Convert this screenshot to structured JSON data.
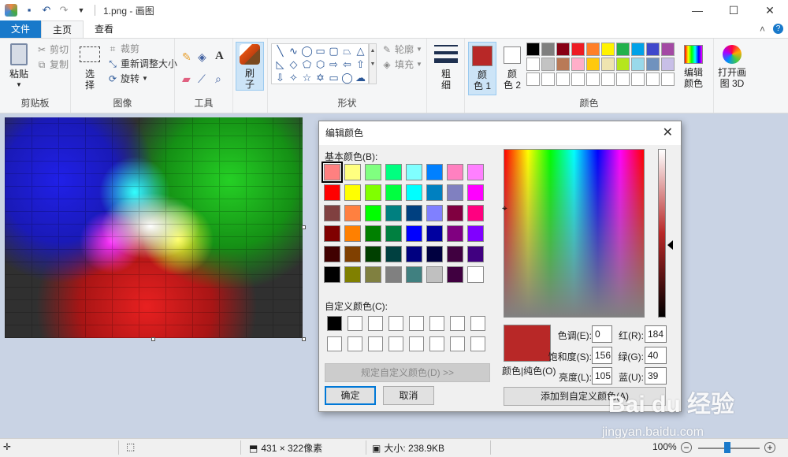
{
  "window": {
    "title": "1.png - 画图",
    "controls": [
      "—",
      "☐",
      "✕"
    ]
  },
  "tabs": {
    "file": "文件",
    "home": "主页",
    "view": "查看"
  },
  "ribbon": {
    "clipboard": {
      "paste": "粘贴",
      "cut": "剪切",
      "copy": "复制",
      "group": "剪贴板"
    },
    "image": {
      "select_line1": "选",
      "select_line2": "择",
      "crop": "裁剪",
      "resize": "重新调整大小",
      "rotate": "旋转",
      "group": "图像"
    },
    "tools": {
      "group": "工具"
    },
    "brush": {
      "line1": "刷",
      "line2": "子"
    },
    "shapes": {
      "outline": "轮廓",
      "fill": "填充",
      "group": "形状"
    },
    "size": {
      "line1": "粗",
      "line2": "细"
    },
    "colors": {
      "color1_line1": "颜",
      "color1_line2": "色 1",
      "color2_line1": "颜",
      "color2_line2": "色 2",
      "edit_line1": "编辑",
      "edit_line2": "颜色",
      "group": "颜色",
      "color1_value": "#b82827",
      "palette": [
        "#000000",
        "#7f7f7f",
        "#880015",
        "#ed1c24",
        "#ff7f27",
        "#fff200",
        "#22b14c",
        "#00a2e8",
        "#3f48cc",
        "#a349a4",
        "#ffffff",
        "#c3c3c3",
        "#b97a57",
        "#ffaec9",
        "#ffc90e",
        "#efe4b0",
        "#b5e61d",
        "#99d9ea",
        "#7092be",
        "#c8bfe7",
        "#ffffff",
        "#ffffff",
        "#ffffff",
        "#ffffff",
        "#ffffff",
        "#ffffff",
        "#ffffff",
        "#ffffff",
        "#ffffff",
        "#ffffff"
      ]
    },
    "paint3d": {
      "line1": "打开画",
      "line2": "图 3D"
    }
  },
  "dialog": {
    "title": "编辑颜色",
    "basic_colors_label": "基本颜色(B):",
    "basic_colors": [
      "#ff8080",
      "#ffff80",
      "#80ff80",
      "#00ff80",
      "#80ffff",
      "#0080ff",
      "#ff80c0",
      "#ff80ff",
      "#ff0000",
      "#ffff00",
      "#80ff00",
      "#00ff40",
      "#00ffff",
      "#0080c0",
      "#8080c0",
      "#ff00ff",
      "#804040",
      "#ff8040",
      "#00ff00",
      "#008080",
      "#004080",
      "#8080ff",
      "#800040",
      "#ff0080",
      "#800000",
      "#ff8000",
      "#008000",
      "#008040",
      "#0000ff",
      "#0000a0",
      "#800080",
      "#8000ff",
      "#400000",
      "#804000",
      "#004000",
      "#004040",
      "#000080",
      "#000040",
      "#400040",
      "#400080",
      "#000000",
      "#808000",
      "#808040",
      "#808080",
      "#408080",
      "#c0c0c0",
      "#400040",
      "#ffffff"
    ],
    "custom_colors_label": "自定义颜色(C):",
    "custom_colors": [
      "#000000",
      "#ffffff",
      "#ffffff",
      "#ffffff",
      "#ffffff",
      "#ffffff",
      "#ffffff",
      "#ffffff",
      "#ffffff",
      "#ffffff",
      "#ffffff",
      "#ffffff",
      "#ffffff",
      "#ffffff",
      "#ffffff",
      "#ffffff"
    ],
    "define_custom": "规定自定义颜色(D) >>",
    "ok": "确定",
    "cancel": "取消",
    "color_solid_label": "颜色|纯色(O)",
    "hue_label": "色调(E):",
    "hue": "0",
    "sat_label": "饱和度(S):",
    "sat": "156",
    "lum_label": "亮度(L):",
    "lum": "105",
    "red_label": "红(R):",
    "red": "184",
    "green_label": "绿(G):",
    "green": "40",
    "blue_label": "蓝(U):",
    "blue": "39",
    "add_custom": "添加到自定义颜色(A)"
  },
  "status": {
    "dimensions": "431 × 322像素",
    "size": "大小: 238.9KB",
    "zoom": "100%"
  },
  "watermark": {
    "brand": "Bai du 经验",
    "url": "jingyan.baidu.com"
  }
}
